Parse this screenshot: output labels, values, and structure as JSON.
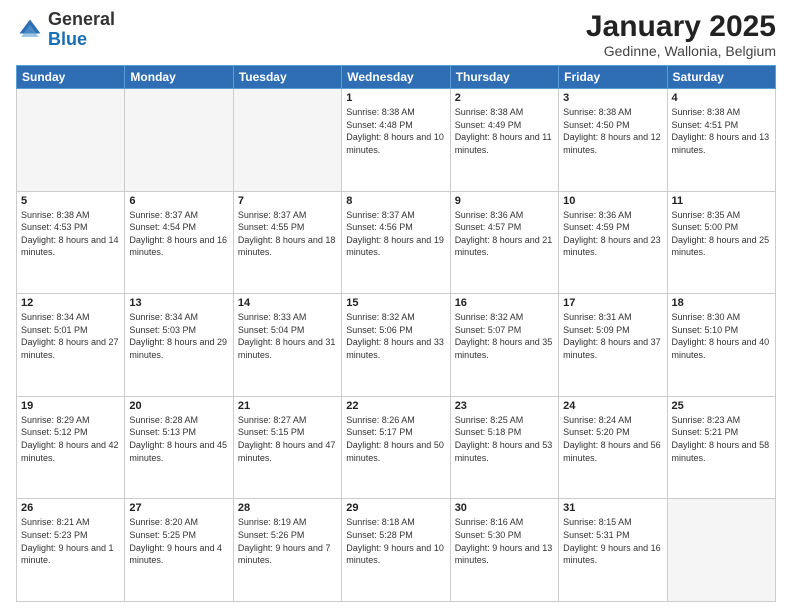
{
  "header": {
    "logo_line1": "General",
    "logo_line2": "Blue",
    "title": "January 2025",
    "subtitle": "Gedinne, Wallonia, Belgium"
  },
  "weekdays": [
    "Sunday",
    "Monday",
    "Tuesday",
    "Wednesday",
    "Thursday",
    "Friday",
    "Saturday"
  ],
  "weeks": [
    [
      {
        "day": "",
        "empty": true
      },
      {
        "day": "",
        "empty": true
      },
      {
        "day": "",
        "empty": true
      },
      {
        "day": "1",
        "sunrise": "8:38 AM",
        "sunset": "4:48 PM",
        "daylight": "8 hours and 10 minutes."
      },
      {
        "day": "2",
        "sunrise": "8:38 AM",
        "sunset": "4:49 PM",
        "daylight": "8 hours and 11 minutes."
      },
      {
        "day": "3",
        "sunrise": "8:38 AM",
        "sunset": "4:50 PM",
        "daylight": "8 hours and 12 minutes."
      },
      {
        "day": "4",
        "sunrise": "8:38 AM",
        "sunset": "4:51 PM",
        "daylight": "8 hours and 13 minutes."
      }
    ],
    [
      {
        "day": "5",
        "sunrise": "8:38 AM",
        "sunset": "4:53 PM",
        "daylight": "8 hours and 14 minutes."
      },
      {
        "day": "6",
        "sunrise": "8:37 AM",
        "sunset": "4:54 PM",
        "daylight": "8 hours and 16 minutes."
      },
      {
        "day": "7",
        "sunrise": "8:37 AM",
        "sunset": "4:55 PM",
        "daylight": "8 hours and 18 minutes."
      },
      {
        "day": "8",
        "sunrise": "8:37 AM",
        "sunset": "4:56 PM",
        "daylight": "8 hours and 19 minutes."
      },
      {
        "day": "9",
        "sunrise": "8:36 AM",
        "sunset": "4:57 PM",
        "daylight": "8 hours and 21 minutes."
      },
      {
        "day": "10",
        "sunrise": "8:36 AM",
        "sunset": "4:59 PM",
        "daylight": "8 hours and 23 minutes."
      },
      {
        "day": "11",
        "sunrise": "8:35 AM",
        "sunset": "5:00 PM",
        "daylight": "8 hours and 25 minutes."
      }
    ],
    [
      {
        "day": "12",
        "sunrise": "8:34 AM",
        "sunset": "5:01 PM",
        "daylight": "8 hours and 27 minutes."
      },
      {
        "day": "13",
        "sunrise": "8:34 AM",
        "sunset": "5:03 PM",
        "daylight": "8 hours and 29 minutes."
      },
      {
        "day": "14",
        "sunrise": "8:33 AM",
        "sunset": "5:04 PM",
        "daylight": "8 hours and 31 minutes."
      },
      {
        "day": "15",
        "sunrise": "8:32 AM",
        "sunset": "5:06 PM",
        "daylight": "8 hours and 33 minutes."
      },
      {
        "day": "16",
        "sunrise": "8:32 AM",
        "sunset": "5:07 PM",
        "daylight": "8 hours and 35 minutes."
      },
      {
        "day": "17",
        "sunrise": "8:31 AM",
        "sunset": "5:09 PM",
        "daylight": "8 hours and 37 minutes."
      },
      {
        "day": "18",
        "sunrise": "8:30 AM",
        "sunset": "5:10 PM",
        "daylight": "8 hours and 40 minutes."
      }
    ],
    [
      {
        "day": "19",
        "sunrise": "8:29 AM",
        "sunset": "5:12 PM",
        "daylight": "8 hours and 42 minutes."
      },
      {
        "day": "20",
        "sunrise": "8:28 AM",
        "sunset": "5:13 PM",
        "daylight": "8 hours and 45 minutes."
      },
      {
        "day": "21",
        "sunrise": "8:27 AM",
        "sunset": "5:15 PM",
        "daylight": "8 hours and 47 minutes."
      },
      {
        "day": "22",
        "sunrise": "8:26 AM",
        "sunset": "5:17 PM",
        "daylight": "8 hours and 50 minutes."
      },
      {
        "day": "23",
        "sunrise": "8:25 AM",
        "sunset": "5:18 PM",
        "daylight": "8 hours and 53 minutes."
      },
      {
        "day": "24",
        "sunrise": "8:24 AM",
        "sunset": "5:20 PM",
        "daylight": "8 hours and 56 minutes."
      },
      {
        "day": "25",
        "sunrise": "8:23 AM",
        "sunset": "5:21 PM",
        "daylight": "8 hours and 58 minutes."
      }
    ],
    [
      {
        "day": "26",
        "sunrise": "8:21 AM",
        "sunset": "5:23 PM",
        "daylight": "9 hours and 1 minute."
      },
      {
        "day": "27",
        "sunrise": "8:20 AM",
        "sunset": "5:25 PM",
        "daylight": "9 hours and 4 minutes."
      },
      {
        "day": "28",
        "sunrise": "8:19 AM",
        "sunset": "5:26 PM",
        "daylight": "9 hours and 7 minutes."
      },
      {
        "day": "29",
        "sunrise": "8:18 AM",
        "sunset": "5:28 PM",
        "daylight": "9 hours and 10 minutes."
      },
      {
        "day": "30",
        "sunrise": "8:16 AM",
        "sunset": "5:30 PM",
        "daylight": "9 hours and 13 minutes."
      },
      {
        "day": "31",
        "sunrise": "8:15 AM",
        "sunset": "5:31 PM",
        "daylight": "9 hours and 16 minutes."
      },
      {
        "day": "",
        "empty": true
      }
    ]
  ]
}
